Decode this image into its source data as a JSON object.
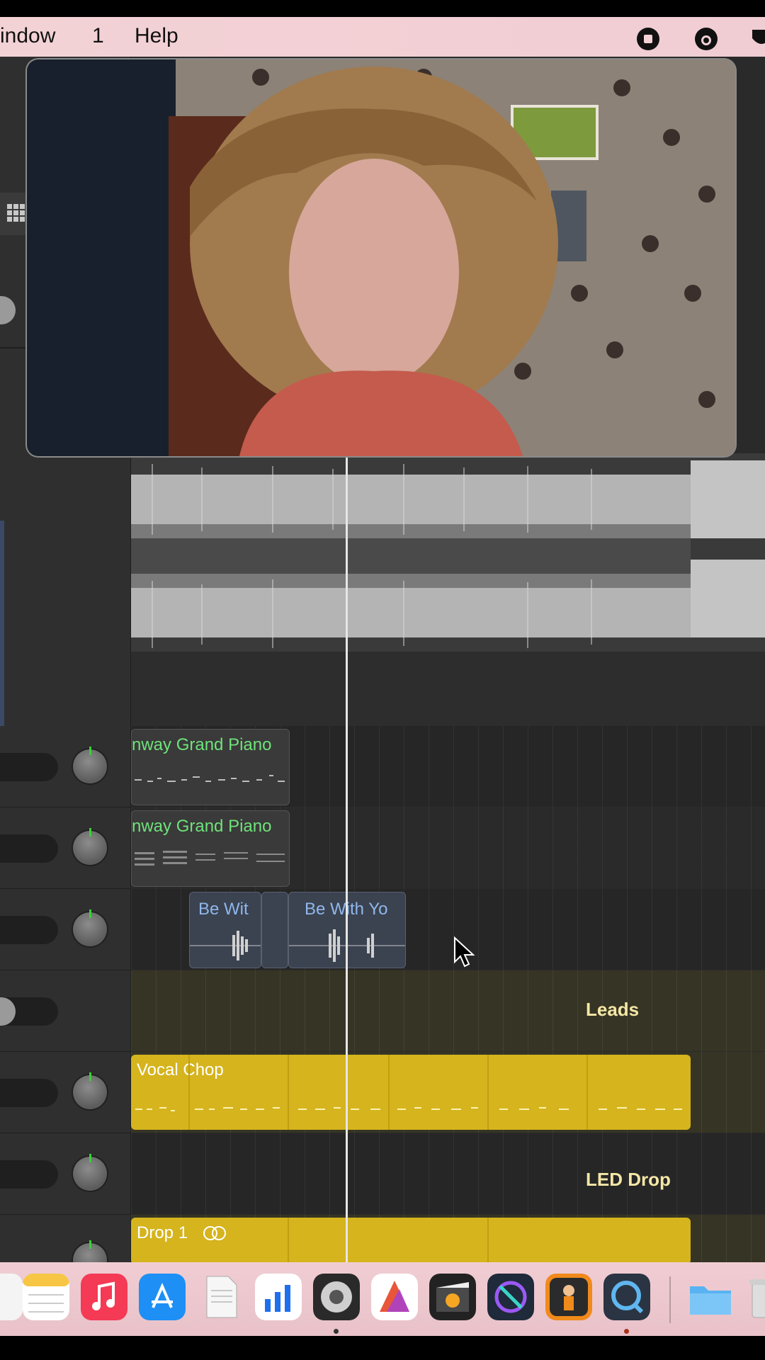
{
  "menubar": {
    "items": [
      "indow",
      "1",
      "Help"
    ]
  },
  "tracks": {
    "piano_region_1": "nway Grand Piano",
    "piano_region_2": "nway Grand Piano",
    "audio_region_1": "Be Wit",
    "audio_region_2": "Be With Yo",
    "leads_title": "Leads",
    "vocal_chop": "Vocal Chop",
    "led_drop_title": "LED Drop",
    "drop_region": "Drop 1"
  },
  "icons": {
    "menubar": [
      "stop-record-icon",
      "control-center-icon",
      "shield-icon"
    ],
    "dock": [
      "finder-partial-icon",
      "notes-icon",
      "music-icon",
      "app-store-icon",
      "textedit-icon",
      "keynote-icon",
      "logic-pro-icon",
      "affinity-icon",
      "final-cut-icon",
      "motion-icon",
      "mainstage-icon",
      "quicktime-icon",
      "folder-icon",
      "trash-icon"
    ]
  },
  "colors": {
    "menubar": "#f3d2d6",
    "region_yellow": "#d5b41e",
    "region_green_text": "#6fe27a",
    "region_blue_text": "#8fb7ec",
    "playhead": "#e6e6e6"
  }
}
